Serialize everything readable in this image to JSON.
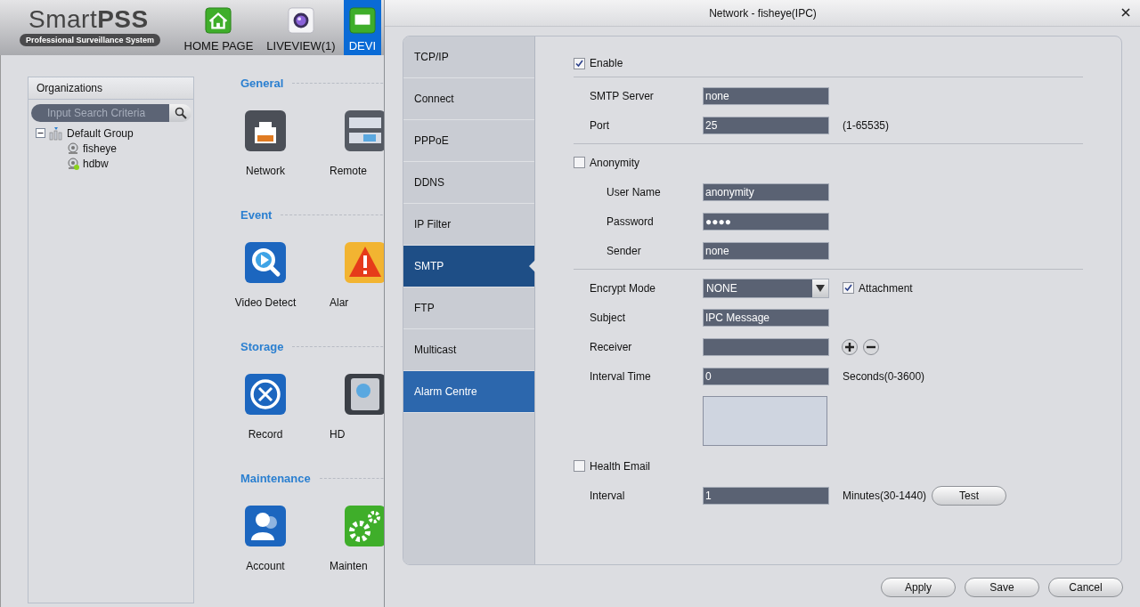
{
  "app": {
    "logo": "Smart**PSS**",
    "tagline": "Professional Surveillance System",
    "nav": [
      {
        "label": "HOME PAGE",
        "kind": "home",
        "selected": false
      },
      {
        "label": "LIVEVIEW(1)",
        "kind": "liveview",
        "selected": false
      },
      {
        "label": "DEVI",
        "kind": "device",
        "selected": true
      }
    ]
  },
  "organizations": {
    "title": "Organizations",
    "search": {
      "placeholder": "Input Search Criteria"
    },
    "tree": [
      {
        "label": "Default Group",
        "expanded": true,
        "children": [
          {
            "label": "fisheye",
            "online": false
          },
          {
            "label": "hdbw",
            "online": true
          }
        ]
      }
    ]
  },
  "sections": [
    {
      "title": "General",
      "items": [
        {
          "label": "Network",
          "kind": "network"
        },
        {
          "label": "Remote",
          "kind": "remote"
        }
      ]
    },
    {
      "title": "Event",
      "items": [
        {
          "label": "Video Detect",
          "kind": "video"
        },
        {
          "label": "Alar",
          "kind": "alarm"
        }
      ]
    },
    {
      "title": "Storage",
      "items": [
        {
          "label": "Record",
          "kind": "record"
        },
        {
          "label": "HD",
          "kind": "hdd"
        }
      ]
    },
    {
      "title": "Maintenance",
      "items": [
        {
          "label": "Account",
          "kind": "account"
        },
        {
          "label": "Mainten",
          "kind": "maintenance"
        }
      ]
    }
  ],
  "dialog": {
    "title": "Network - fisheye(IPC)",
    "tabs": [
      {
        "label": "TCP/IP",
        "selected": false,
        "highlighted": false
      },
      {
        "label": "Connect",
        "selected": false,
        "highlighted": false
      },
      {
        "label": "PPPoE",
        "selected": false,
        "highlighted": false
      },
      {
        "label": "DDNS",
        "selected": false,
        "highlighted": false
      },
      {
        "label": "IP Filter",
        "selected": false,
        "highlighted": false
      },
      {
        "label": "SMTP",
        "selected": true,
        "highlighted": false
      },
      {
        "label": "FTP",
        "selected": false,
        "highlighted": false
      },
      {
        "label": "Multicast",
        "selected": false,
        "highlighted": false
      },
      {
        "label": "Alarm Centre",
        "selected": false,
        "highlighted": true
      }
    ],
    "groups": [
      {
        "rows": [
          {
            "kind": "checkbox",
            "label": "Enable",
            "checked": true
          }
        ]
      },
      {
        "rows": [
          {
            "kind": "field",
            "label": "SMTP Server",
            "value": "none"
          },
          {
            "kind": "field",
            "label": "Port",
            "value": "25",
            "note": "(1-65535)"
          }
        ]
      },
      {
        "rows": [
          {
            "kind": "checkbox",
            "label": "Anonymity",
            "checked": false,
            "children": [
              {
                "kind": "field",
                "label": "User Name",
                "value": "anonymity"
              },
              {
                "kind": "field",
                "label": "Password",
                "value": "●●●●"
              },
              {
                "kind": "field",
                "label": "Sender",
                "value": "none"
              }
            ]
          }
        ]
      },
      {
        "rows": [
          {
            "kind": "select",
            "label": "Encrypt Mode",
            "value": "NONE",
            "option": {
              "label": "Attachment",
              "checked": true
            }
          },
          {
            "kind": "field",
            "label": "Subject",
            "value": "IPC Message"
          },
          {
            "kind": "addremove",
            "label": "Receiver"
          },
          {
            "kind": "field",
            "label": "Interval Time",
            "value": "0",
            "note": "Seconds(0-3600)"
          },
          {
            "kind": "listbox"
          },
          {
            "kind": "checkbox",
            "label": "Health Email",
            "checked": false
          },
          {
            "kind": "field",
            "label": "Interval",
            "value": "1",
            "note": "Minutes(30-1440)",
            "button": "Test"
          }
        ]
      }
    ],
    "buttons": [
      "Apply",
      "Save",
      "Cancel"
    ]
  }
}
